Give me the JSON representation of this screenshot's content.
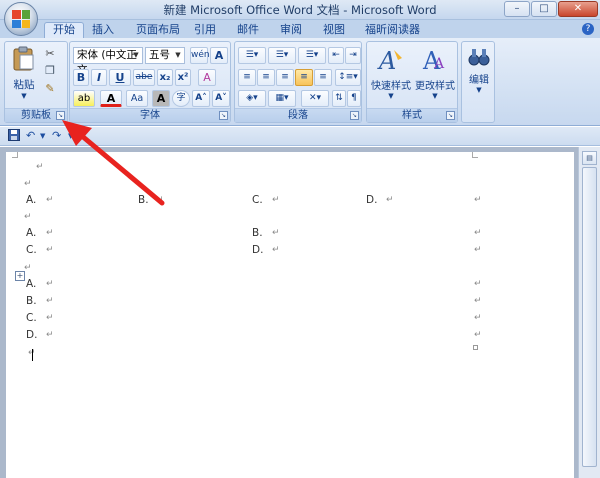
{
  "window": {
    "title": "新建 Microsoft Office Word 文档 - Microsoft Word",
    "minimize": "–",
    "maximize": "□",
    "close": "✕"
  },
  "tabs": [
    {
      "label": "开始",
      "active": true
    },
    {
      "label": "插入"
    },
    {
      "label": "页面布局"
    },
    {
      "label": "引用"
    },
    {
      "label": "邮件"
    },
    {
      "label": "审阅"
    },
    {
      "label": "视图"
    },
    {
      "label": "福昕阅读器"
    }
  ],
  "ribbon": {
    "clipboard": {
      "label": "剪贴板",
      "paste": "粘贴"
    },
    "font": {
      "label": "字体",
      "font_name": "宋体 (中文正文",
      "font_size": "五号",
      "bold": "B",
      "italic": "I",
      "underline": "U",
      "strike": "abe",
      "subscript": "x₂",
      "superscript": "x²",
      "clear": "A",
      "grow": "A˄",
      "shrink": "A˅",
      "case": "Aa",
      "phonetic": "wén",
      "charborder": "A",
      "font_color": "A",
      "shading": "A",
      "enclose": "字"
    },
    "paragraph": {
      "label": "段落"
    },
    "styles": {
      "label": "样式",
      "quick_styles": "快速样式",
      "change_styles": "更改样式"
    },
    "editing": {
      "label": "编辑"
    }
  },
  "document": {
    "row1": [
      "A.",
      "B.",
      "C.",
      "D."
    ],
    "row2": [
      "A.",
      "B."
    ],
    "row3": [
      "C.",
      "D."
    ],
    "rows_vertical": [
      "A.",
      "B.",
      "C.",
      "D."
    ],
    "mark": "↵"
  },
  "colors": {
    "accent": "#15428b",
    "arrow": "#e8231f",
    "ribbon": "#d3e1f3"
  }
}
